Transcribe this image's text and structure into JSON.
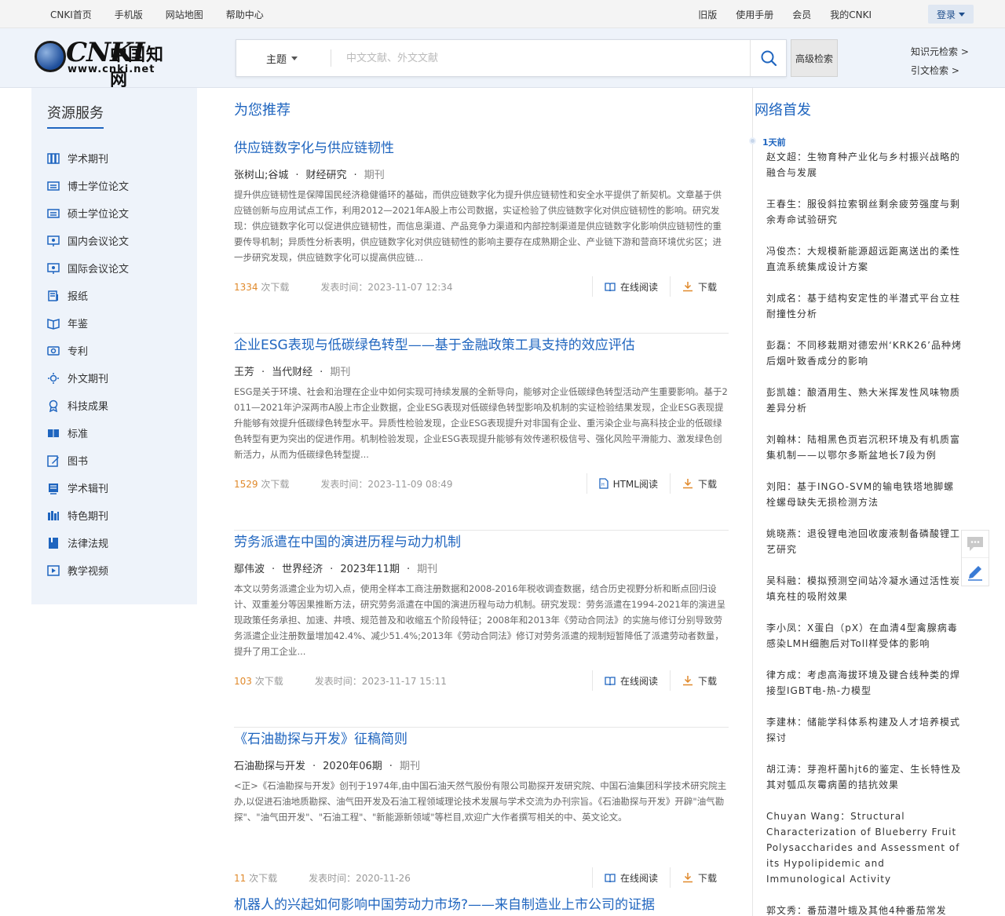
{
  "topbar": {
    "left_links": [
      "CNKI首页",
      "手机版",
      "网站地图",
      "帮助中心"
    ],
    "right_links": [
      "旧版",
      "使用手册",
      "会员",
      "我的CNKI"
    ],
    "login_label": "登录"
  },
  "header": {
    "logo_brand": "CNKI",
    "logo_cn": "中国知网",
    "logo_url": "www.cnki.net",
    "search_field": "主题",
    "search_placeholder": "中文文献、外文文献",
    "advanced_label": "高级检索",
    "quick_links": [
      "知识元检索 >",
      "引文检索 >"
    ]
  },
  "sidebar": {
    "title": "资源服务",
    "items": [
      "学术期刊",
      "博士学位论文",
      "硕士学位论文",
      "国内会议论文",
      "国际会议论文",
      "报纸",
      "年鉴",
      "专利",
      "外文期刊",
      "科技成果",
      "标准",
      "图书",
      "学术辑刊",
      "特色期刊",
      "法律法规",
      "教学视频"
    ]
  },
  "main": {
    "section_title": "为您推荐",
    "articles": [
      {
        "title": "供应链数字化与供应链韧性",
        "meta": [
          "张树山;谷城",
          "财经研究"
        ],
        "type": "期刊",
        "abstract": "提升供应链韧性是保障国民经济稳健循环的基础，而供应链数字化为提升供应链韧性和安全水平提供了新契机。文章基于供应链创新与应用试点工作，利用2012—2021年A股上市公司数据，实证检验了供应链数字化对供应链韧性的影响。研究发现：供应链数字化可以促进供应链韧性，而信息渠道、产品竞争力渠道和内部控制渠道是供应链数字化影响供应链韧性的重要传导机制；异质性分析表明，供应链数字化对供应链韧性的影响主要存在成熟期企业、产业链下游和营商环境优劣区；进一步研究发现，供应链数字化可以提高供应链...",
        "downloads": "1334",
        "downloads_suffix": "次下载",
        "time": "发表时间：2023-11-07 12:34",
        "read_label": "在线阅读",
        "download_label": "下载"
      },
      {
        "title": "企业ESG表现与低碳绿色转型——基于金融政策工具支持的效应评估",
        "meta": [
          "王芳",
          "当代财经"
        ],
        "type": "期刊",
        "abstract": "ESG是关于环境、社会和治理在企业中如何实现可持续发展的全新导向，能够对企业低碳绿色转型活动产生重要影响。基于2011—2021年沪深两市A股上市企业数据，企业ESG表现对低碳绿色转型影响及机制的实证检验结果发现，企业ESG表现提升能够有效提升低碳绿色转型水平。异质性检验发现，企业ESG表现提升对非国有企业、重污染企业与高科技企业的低碳绿色转型有更为突出的促进作用。机制检验发现，企业ESG表现提升能够有效传递积极信号、强化风险平滑能力、激发绿色创新活力，从而为低碳绿色转型提...",
        "downloads": "1529",
        "downloads_suffix": "次下载",
        "time": "发表时间：2023-11-09 08:49",
        "read_label": "HTML阅读",
        "download_label": "下载"
      },
      {
        "title": "劳务派遣在中国的演进历程与动力机制",
        "meta": [
          "鄢伟波",
          "世界经济",
          "2023年11期"
        ],
        "type": "期刊",
        "abstract": "本文以劳务派遣企业为切入点，使用全样本工商注册数据和2008-2016年税收调查数据，结合历史视野分析和断点回归设计、双重差分等因果推断方法，研究劳务派遣在中国的演进历程与动力机制。研究发现：劳务派遣在1994-2021年的演进呈现政策任务承担、加速、井喷、规范普及和收缩五个阶段特征；2008年和2013年《劳动合同法》的实施与修订分别导致劳务派遣企业注册数量增加42.4%、减少51.4%;2013年《劳动合同法》修订对劳务派遣的规制短暂降低了派遣劳动者数量，提升了用工企业...",
        "downloads": "103",
        "downloads_suffix": "次下载",
        "time": "发表时间：2023-11-17 15:11",
        "read_label": "在线阅读",
        "download_label": "下载"
      },
      {
        "title": "《石油勘探与开发》征稿简则",
        "meta": [
          "石油勘探与开发",
          "2020年06期"
        ],
        "type": "期刊",
        "abstract": "<正>《石油勘探与开发》创刊于1974年,由中国石油天然气股份有限公司勘探开发研究院、中国石油集团科学技术研究院主办,以促进石油地质勘探、油气田开发及石油工程领域理论技术发展与学术交流为办刊宗旨。《石油勘探与开发》开辟\"油气勘探\"、\"油气田开发\"、\"石油工程\"、\"新能源新领域\"等栏目,欢迎广大作者撰写相关的中、英文论文。",
        "downloads": "11",
        "downloads_suffix": "次下载",
        "time": "发表时间：2020-11-26",
        "read_label": "在线阅读",
        "download_label": "下载"
      },
      {
        "title": "机器人的兴起如何影响中国劳动力市场?——来自制造业上市公司的证据"
      }
    ]
  },
  "rightcol": {
    "title": "网络首发",
    "day_label": "1天前",
    "feed": [
      {
        "author": "赵文超：",
        "title": "生物育种产业化与乡村振兴战略的融合与发展"
      },
      {
        "author": "王春生：",
        "title": "服役斜拉索钢丝剩余疲劳强度与剩余寿命试验研究"
      },
      {
        "author": "冯俊杰：",
        "title": "大规模新能源超远距离送出的柔性直流系统集成设计方案"
      },
      {
        "author": "刘成名：",
        "title": "基于结构安定性的半潜式平台立柱耐撞性分析"
      },
      {
        "author": "彭磊：",
        "title": "不同移栽期对德宏州‘KRK26’品种烤后烟叶致香成分的影响"
      },
      {
        "author": "彭凯雄：",
        "title": "酿酒用生、熟大米挥发性风味物质差异分析"
      },
      {
        "author": "刘翰林：",
        "title": "陆相黑色页岩沉积环境及有机质富集机制——以鄂尔多斯盆地长7段为例"
      },
      {
        "author": "刘阳：",
        "title": "基于INGO-SVM的输电铁塔地脚螺栓螺母缺失无损检测方法"
      },
      {
        "author": "姚晓燕：",
        "title": "退役锂电池回收废液制备磷酸锂工艺研究"
      },
      {
        "author": "吴科融：",
        "title": "模拟预测空间站冷凝水通过活性炭填充柱的吸附效果"
      },
      {
        "author": "李小凤：",
        "title": "X蛋白（pX）在血清4型禽腺病毒感染LMH细胞后对Toll样受体的影响"
      },
      {
        "author": "律方成：",
        "title": "考虑高海拔环境及键合线种类的焊接型IGBT电-热-力模型"
      },
      {
        "author": "李建林：",
        "title": "储能学科体系构建及人才培养模式探讨"
      },
      {
        "author": "胡江涛：",
        "title": "芽孢杆菌hjt6的鉴定、生长特性及其对瓠瓜灰霉病菌的拮抗效果"
      },
      {
        "author": "Chuyan Wang：",
        "title": "Structural Characterization of Blueberry Fruit Polysaccharides and Assessment of its Hypolipidemic and Immunological Activity"
      },
      {
        "author": "郭文秀：",
        "title": "番茄潜叶蛾及其他4种番茄常发"
      }
    ]
  },
  "colors": {
    "brand_blue": "#1f65bf",
    "download_orange": "#e0892b",
    "panel_bg": "#eef3fa"
  }
}
